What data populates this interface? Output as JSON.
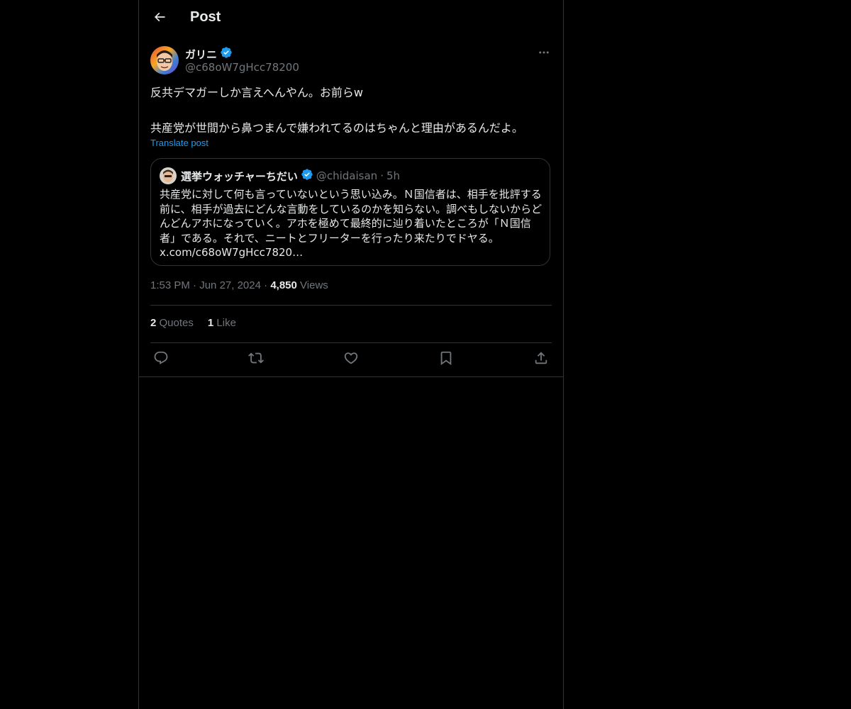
{
  "header": {
    "title": "Post"
  },
  "post": {
    "author_name": "ガリニ",
    "author_handle": "@c68oW7gHcc78200",
    "text": "反共デマガーしか言えへんやん。お前らw\n\n共産党が世間から鼻つまんで嫌われてるのはちゃんと理由があるんだよ。",
    "translate_label": "Translate post",
    "time": "1:53 PM",
    "date": "Jun 27, 2024",
    "views_count": "4,850",
    "views_label": "Views",
    "separator": "·"
  },
  "quote": {
    "name": "選挙ウォッチャーちだい",
    "handle": "@chidaisan",
    "separator": "·",
    "age": "5h",
    "text": "共産党に対して何も言っていないという思い込み。Ｎ国信者は、相手を批評する前に、相手が過去にどんな言動をしているのかを知らない。調べもしないからどんどんアホになっていく。アホを極めて最終的に辿り着いたところが「Ｎ国信者」である。それで、ニートとフリーターを行ったり来たりでドヤる。\nx.com/c68oW7gHcc7820…"
  },
  "stats": {
    "quotes_count": "2",
    "quotes_label": "Quotes",
    "likes_count": "1",
    "likes_label": "Like"
  },
  "icons": {
    "back": "back-arrow-icon",
    "verified": "verified-badge-icon",
    "more": "more-icon",
    "reply": "reply-icon",
    "repost": "repost-icon",
    "like": "like-icon",
    "bookmark": "bookmark-icon",
    "share": "share-icon"
  },
  "colors": {
    "background": "#000000",
    "text": "#e7e9ea",
    "muted": "#71767b",
    "accent": "#1d9bf0",
    "border": "#2f3336"
  }
}
